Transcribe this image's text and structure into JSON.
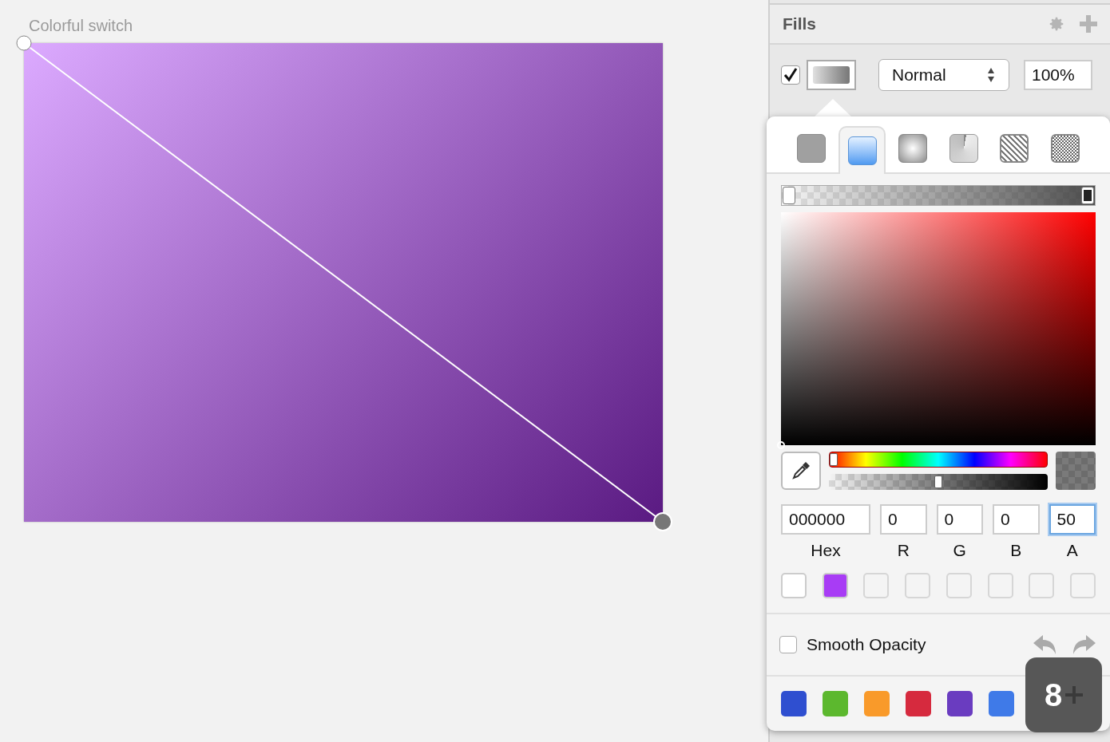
{
  "canvas": {
    "artboard_title": "Colorful switch"
  },
  "inspector": {
    "section_title": "Fills",
    "fills": [
      {
        "enabled": true,
        "blend_mode": "Normal",
        "opacity": "100%"
      }
    ]
  },
  "color_picker": {
    "fill_types": [
      {
        "kind": "solid",
        "selected": false
      },
      {
        "kind": "linear",
        "selected": true
      },
      {
        "kind": "radial",
        "selected": false
      },
      {
        "kind": "angular",
        "selected": false
      },
      {
        "kind": "pattern",
        "selected": false
      },
      {
        "kind": "noise",
        "selected": false
      }
    ],
    "gradient_stops": [
      {
        "selected": false
      },
      {
        "selected": true
      }
    ],
    "hue": {
      "level": 0
    },
    "alpha": {
      "level": 0.5
    },
    "fields": [
      {
        "label": "Hex",
        "value": "000000",
        "focused": false
      },
      {
        "label": "R",
        "value": "0",
        "focused": false
      },
      {
        "label": "G",
        "value": "0",
        "focused": false
      },
      {
        "label": "B",
        "value": "0",
        "focused": false
      },
      {
        "label": "A",
        "value": "50",
        "focused": true
      }
    ],
    "recent_colors": [
      {
        "kind": "color",
        "color": "#ffffff"
      },
      {
        "kind": "color",
        "color": "#a83cf5"
      },
      {
        "kind": "empty"
      },
      {
        "kind": "empty"
      },
      {
        "kind": "empty"
      },
      {
        "kind": "empty"
      },
      {
        "kind": "empty"
      },
      {
        "kind": "empty"
      }
    ],
    "smooth_opacity": {
      "label": "Smooth Opacity",
      "checked": false
    },
    "presets": [
      {
        "color": "#2f4fd0"
      },
      {
        "color": "#5cb82e"
      },
      {
        "color": "#f99a2a"
      },
      {
        "color": "#d62a3e"
      },
      {
        "color": "#6a3cc0"
      },
      {
        "color": "#3f7ae8"
      }
    ]
  },
  "key_overlay": {
    "key": "8"
  }
}
